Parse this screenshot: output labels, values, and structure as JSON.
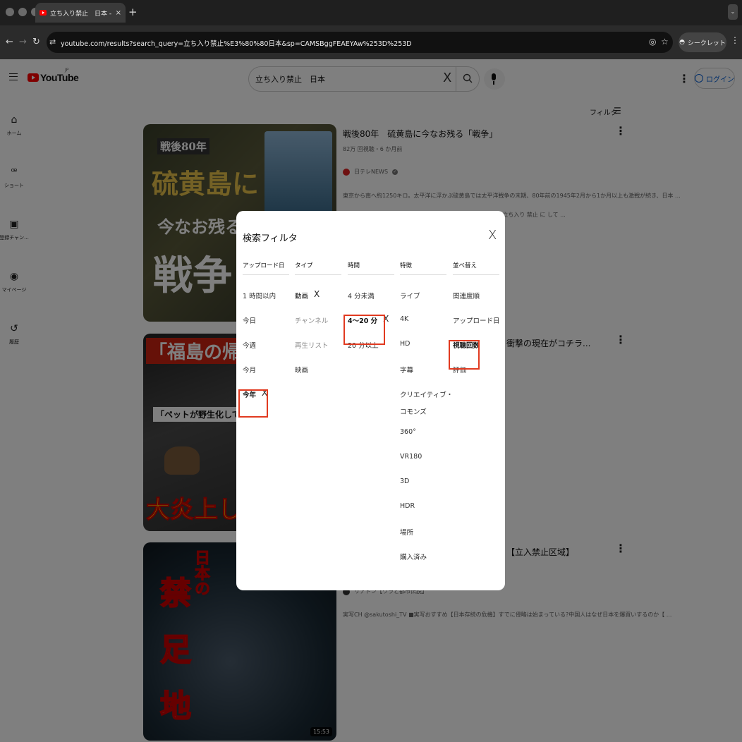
{
  "browser": {
    "tab_title": "立ち入り禁止　日本 - YouTube",
    "tab_close": "×",
    "new_tab": "+",
    "tab_menu": "⌄",
    "url": "youtube.com/results?search_query=立ち入り禁止%E3%80%80日本&sp=CAMSBggFEAEYAw%253D%253D",
    "incognito_label": "シークレット"
  },
  "header": {
    "logo_text": "YouTube",
    "logo_region": "JP",
    "search_value": "立ち入り禁止　日本",
    "search_clear": "X",
    "login_label": "ログイン"
  },
  "sidebar": {
    "items": [
      {
        "label": "ホーム",
        "icon": "home-icon"
      },
      {
        "label": "ショート",
        "icon": "shorts-icon"
      },
      {
        "label": "登録チャン...",
        "icon": "subscriptions-icon"
      },
      {
        "label": "マイページ",
        "icon": "profile-icon"
      },
      {
        "label": "履歴",
        "icon": "history-icon"
      }
    ]
  },
  "filter_button": {
    "label": "フィルタ"
  },
  "results": [
    {
      "title": "戦後80年　硫黄島に今なお残る「戦争」",
      "meta": "82万 回視聴・6 か月前",
      "channel": "日テレNEWS",
      "desc1": "東京から南へ約1250キロ。太平洋に浮かぶ硫黄島では太平洋戦争の末期、80年前の1945年2月から1か月以上も激戦が続き、日本 ...",
      "desc2": "の 半径 1km 加工 から 半径 1km立ち入り 禁止 に して ...",
      "thumb_text": [
        "戦後80年",
        "硫黄島に",
        "今なお残る",
        "戦争"
      ]
    },
    {
      "title": "衝撃の現在がコチラ...",
      "thumb_text": [
        "「福島の帰宅困難",
        "「ペットが野生化している」",
        "大炎上したYou"
      ]
    },
    {
      "title": "【立入禁止区域】",
      "channel": "リアドン【ワラと都市伝説】",
      "desc1": "実写CH @sakutoshi_TV ■実写おすすめ【日本存続の危機】すでに侵略は始まっている?中国人はなぜ日本を爆買いするのか【 ...",
      "thumb_text": [
        "日本の",
        "禁",
        "足",
        "地"
      ],
      "duration": "15:53"
    }
  ],
  "dialog": {
    "title": "検索フィルタ",
    "close": "X",
    "columns": [
      {
        "header": "アップロード日",
        "options": [
          {
            "label": "1 時間以内"
          },
          {
            "label": "今日"
          },
          {
            "label": "今週"
          },
          {
            "label": "今月"
          },
          {
            "label": "今年",
            "selected": true,
            "remove": "X"
          }
        ]
      },
      {
        "header": "タイプ",
        "options": [
          {
            "label": "動画",
            "remove": "X"
          },
          {
            "label": "チャンネル",
            "dim": true
          },
          {
            "label": "再生リスト",
            "dim": true
          },
          {
            "label": "映画"
          }
        ]
      },
      {
        "header": "時間",
        "options": [
          {
            "label": "4 分未満"
          },
          {
            "label": "4～20 分",
            "selected": true,
            "remove": "X"
          },
          {
            "label": "20 分以上"
          }
        ]
      },
      {
        "header": "特徴",
        "options": [
          {
            "label": "ライブ"
          },
          {
            "label": "4K"
          },
          {
            "label": "HD"
          },
          {
            "label": "字幕"
          },
          {
            "label": "クリエイティブ・",
            "label2": "コモンズ"
          },
          {
            "label": "360°"
          },
          {
            "label": "VR180"
          },
          {
            "label": "3D"
          },
          {
            "label": "HDR"
          },
          {
            "label": "場所"
          },
          {
            "label": "購入済み"
          }
        ]
      },
      {
        "header": "並べ替え",
        "options": [
          {
            "label": "関連度順"
          },
          {
            "label": "アップロード日"
          },
          {
            "label": "視聴回数",
            "selected": true
          },
          {
            "label": "評価"
          }
        ]
      }
    ]
  },
  "colors": {
    "highlight": "#e13a20",
    "brand_red": "#ff0000",
    "link_blue": "#065fd4"
  }
}
